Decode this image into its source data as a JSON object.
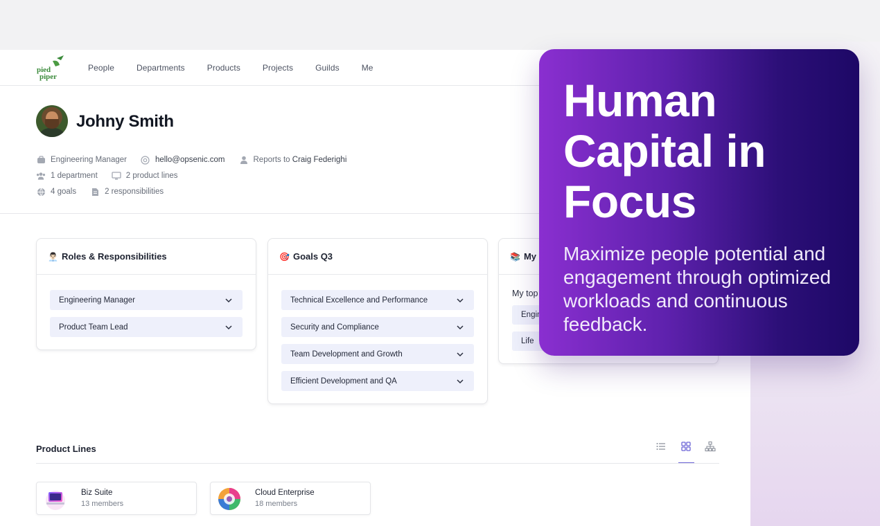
{
  "nav": {
    "logo_text": "pied piper",
    "items": [
      "People",
      "Departments",
      "Products",
      "Projects",
      "Guilds",
      "Me"
    ]
  },
  "profile": {
    "name": "Johny Smith",
    "title": "Engineering Manager",
    "email": "hello@opsenic.com",
    "reports_to_label": "Reports to",
    "reports_to_name": "Craig Federighi",
    "departments": "1 department",
    "product_lines": "2 product lines",
    "goals": "4 goals",
    "responsibilities": "2 responsibilities"
  },
  "cards": {
    "roles": {
      "emoji": "👨🏻‍💼",
      "title": "Roles & Responsibilities",
      "items": [
        "Engineering Manager",
        "Product Team Lead"
      ]
    },
    "goals": {
      "emoji": "🎯",
      "title": "Goals Q3",
      "items": [
        "Technical Excellence and Performance",
        "Security and Compliance",
        "Team Development and Growth",
        "Efficient Development and QA"
      ]
    },
    "my": {
      "emoji": "📚",
      "title": "My b",
      "text": "My top",
      "items": [
        "Engin",
        "Life"
      ]
    }
  },
  "product_lines": {
    "title": "Product Lines",
    "items": [
      {
        "name": "Biz Suite",
        "members": "13 members"
      },
      {
        "name": "Cloud Enterprise",
        "members": "18 members"
      }
    ]
  },
  "hero": {
    "headline": "Human Capital in Focus",
    "body": "Maximize people potential and engagement through optimized workloads and continuous feedback."
  },
  "colors": {
    "accent": "#6b63d6",
    "accordion_bg": "#eef0fb",
    "hero_start": "#8a2fd0",
    "hero_end": "#1d0866",
    "logo_green": "#3a8a3a"
  }
}
